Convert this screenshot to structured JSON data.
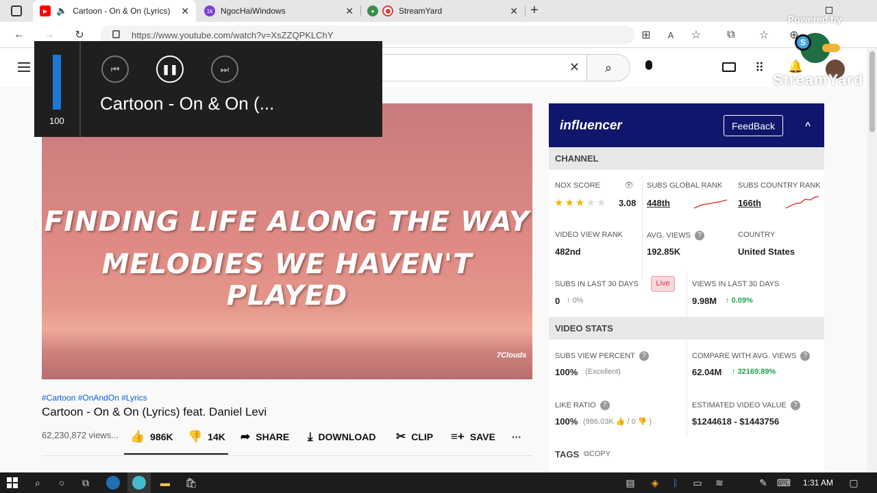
{
  "browser": {
    "tabs": [
      {
        "title": "Cartoon - On & On (Lyrics)",
        "close": "✕"
      },
      {
        "title": "NgocHaiWindows",
        "close": "✕"
      },
      {
        "title": "StreamYard",
        "close": "✕"
      }
    ],
    "new_tab": "+",
    "url": "https://www.youtube.com/watch?v=XsZZQPKLChY"
  },
  "media_overlay": {
    "volume": "100",
    "volume_level": 1.0,
    "track_title": "Cartoon - On & On (..."
  },
  "video": {
    "line1": "FINDING LIFE ALONG THE WAY",
    "line2": "MELODIES WE HAVEN'T PLAYED",
    "logo": "7Clouds"
  },
  "watch": {
    "hashtags": "#Cartoon #OnAndOn #Lyrics",
    "title": "Cartoon - On & On (Lyrics) feat. Daniel Levi",
    "views": "62,230,872 views...",
    "likes": "986K",
    "dislikes": "14K",
    "share": "SHARE",
    "download": "DOWNLOAD",
    "clip": "CLIP",
    "save": "SAVE",
    "more": "···"
  },
  "influencer": {
    "logo": "influencer",
    "feedback": "FeedBack",
    "channel_header": "CHANNEL",
    "nox_score_label": "NOX SCORE",
    "nox_score": "3.08",
    "nox_stars": 3,
    "subs_global_rank_label": "SUBS GLOBAL RANK",
    "subs_global_rank": "448th",
    "subs_country_rank_label": "SUBS COUNTRY RANK",
    "subs_country_rank": "166th",
    "video_view_rank_label": "VIDEO VIEW RANK",
    "video_view_rank": "482nd",
    "avg_views_label": "AVG. VIEWS",
    "avg_views": "192.85K",
    "country_label": "COUNTRY",
    "country": "United States",
    "subs_30_label": "SUBS IN LAST 30 DAYS",
    "live_badge": "Live",
    "subs_30": "0",
    "subs_30_change": "0%",
    "views_30_label": "VIEWS IN LAST 30 DAYS",
    "views_30": "9.98M",
    "views_30_change": "0.09%",
    "video_stats_header": "VIDEO STATS",
    "subs_view_percent_label": "SUBS VIEW PERCENT",
    "subs_view_percent": "100%",
    "subs_view_note": "(Excellent)",
    "compare_label": "COMPARE WITH AVG. VIEWS",
    "compare_value": "62.04M",
    "compare_change": "32169.89%",
    "like_ratio_label": "LIKE RATIO",
    "like_ratio": "100%",
    "like_detail_open": "(986.03K",
    "like_detail_sep": "/ 0",
    "like_detail_close": ")",
    "est_value_label": "ESTIMATED VIDEO VALUE",
    "est_value": "$1244618 - $1443756",
    "tags_label": "TAGS",
    "copy_label": "COPY"
  },
  "watermark": {
    "top": "Powered by",
    "bottom": "StreamYard"
  },
  "taskbar": {
    "time": "1:31 AM"
  },
  "colors": {
    "influencer_header": "#10166b",
    "green": "#1ea34a",
    "live_badge": "#f8d7da",
    "volume_fill": "#1a7ad6"
  }
}
